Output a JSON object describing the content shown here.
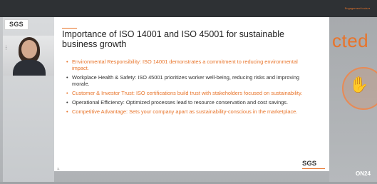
{
  "topbar": {
    "text": "Engagement tools ▾"
  },
  "sidebar": {
    "badge_text": "SGS"
  },
  "video": {
    "icon": "handle-icon"
  },
  "slide": {
    "title": "Importance of ISO 14001 and ISO 45001 for sustainable business growth",
    "bullets": [
      {
        "text": "Environmental Responsibility: ISO 14001 demonstrates a commitment to reducing environmental impact.",
        "color": "#e8742a"
      },
      {
        "text": "Workplace Health & Safety: ISO 45001 prioritizes worker well-being, reducing risks and improving morale.",
        "color": "#333333"
      },
      {
        "text": "Customer & Investor Trust: ISO certifications build trust with stakeholders focused on sustainability.",
        "color": "#e8742a"
      },
      {
        "text": "Operational Efficiency: Optimized processes lead to resource conservation and cost savings.",
        "color": "#333333"
      },
      {
        "text": "Competitive Advantage: Sets your company apart as sustainability-conscious in the marketplace.",
        "color": "#e8742a"
      }
    ],
    "page_number": "11",
    "footer_logo": "SGS"
  },
  "background_right": {
    "text": "cted"
  },
  "footer": {
    "brand": "ON24"
  },
  "colors": {
    "accent": "#e8742a",
    "topbar": "#2e3134"
  }
}
